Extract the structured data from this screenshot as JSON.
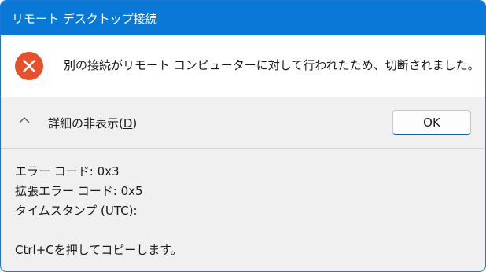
{
  "window": {
    "title": "リモート デスクトップ接続"
  },
  "message": {
    "icon": "error-icon",
    "icon_color": "#e8502a",
    "text": "別の接続がリモート コンピューターに対して行われたため、切断されました。"
  },
  "details_toggle": {
    "icon": "chevron-up-icon",
    "label_prefix": "詳細の非表示(",
    "label_access_key": "D",
    "label_suffix": ")"
  },
  "buttons": {
    "ok_label": "OK"
  },
  "details": {
    "error_code": "エラー コード: 0x3",
    "extended_error_code": "拡張エラー コード: 0x5",
    "timestamp": "タイムスタンプ (UTC):",
    "copy_hint": "Ctrl+Cを押してコピーします。"
  },
  "colors": {
    "titlebar": "#0a78d6",
    "accent": "#0a5fb4"
  }
}
